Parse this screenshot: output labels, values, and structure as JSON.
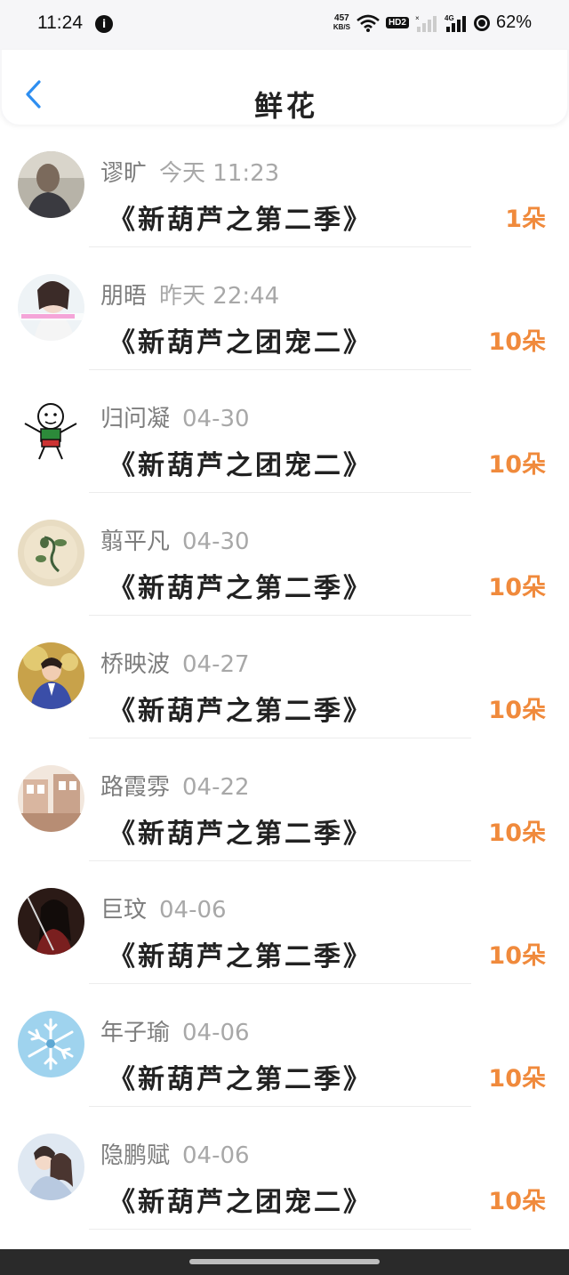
{
  "status_bar": {
    "time": "11:24",
    "notif_glyph": "i",
    "net_speed_value": "457",
    "net_speed_unit": "KB/S",
    "hd_label": "HD2",
    "battery": "62%"
  },
  "header": {
    "title": "鲜花",
    "back_icon": "chevron-left-icon"
  },
  "colors": {
    "accent": "#2e8ef0",
    "amount": "#f08a3c",
    "meta_name": "#7d7d7d",
    "meta_time": "#a8a8a8"
  },
  "items": [
    {
      "name": "谬旷",
      "time": "今天 11:23",
      "book": "《新葫芦之第二季》",
      "amount": "1朵"
    },
    {
      "name": "朋晤",
      "time": "昨天 22:44",
      "book": "《新葫芦之团宠二》",
      "amount": "10朵"
    },
    {
      "name": "归问凝",
      "time": "04-30",
      "book": "《新葫芦之团宠二》",
      "amount": "10朵"
    },
    {
      "name": "翦平凡",
      "time": "04-30",
      "book": "《新葫芦之第二季》",
      "amount": "10朵"
    },
    {
      "name": "桥映波",
      "time": "04-27",
      "book": "《新葫芦之第二季》",
      "amount": "10朵"
    },
    {
      "name": "路霞雰",
      "time": "04-22",
      "book": "《新葫芦之第二季》",
      "amount": "10朵"
    },
    {
      "name": "巨玟",
      "time": "04-06",
      "book": "《新葫芦之第二季》",
      "amount": "10朵"
    },
    {
      "name": "年子瑜",
      "time": "04-06",
      "book": "《新葫芦之第二季》",
      "amount": "10朵"
    },
    {
      "name": "隐鹏赋",
      "time": "04-06",
      "book": "《新葫芦之团宠二》",
      "amount": "10朵"
    }
  ]
}
